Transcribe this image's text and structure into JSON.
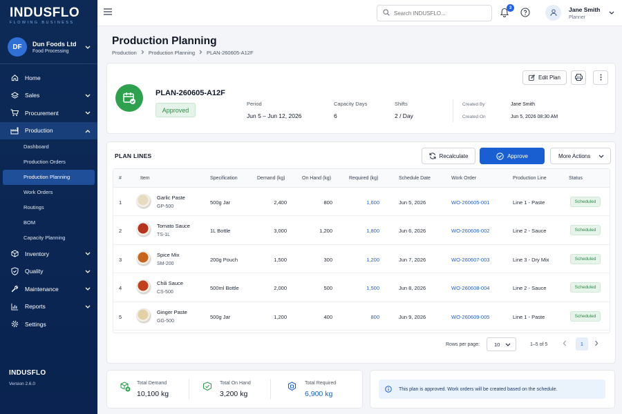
{
  "sidebar": {
    "brand": "INDUSFLO",
    "tagline": "FLOWING BUSINESS",
    "company": {
      "initials": "DF",
      "name": "Dun Foods Ltd",
      "sub": "Food Processing"
    },
    "nav": [
      {
        "label": "Home",
        "icon": "home-icon"
      },
      {
        "label": "Sales",
        "icon": "sales-icon"
      },
      {
        "label": "Procurement",
        "icon": "cart-icon"
      },
      {
        "label": "Production",
        "icon": "factory-icon"
      }
    ],
    "production_sub": [
      "Dashboard",
      "Production Orders",
      "Production Planning",
      "Work Orders",
      "Routings",
      "BOM",
      "Capacity Planning"
    ],
    "nav_bottom": [
      {
        "label": "Inventory",
        "icon": "box-icon"
      },
      {
        "label": "Quality",
        "icon": "shield-check-icon"
      },
      {
        "label": "Maintenance",
        "icon": "wrench-icon"
      },
      {
        "label": "Reports",
        "icon": "chart-icon"
      },
      {
        "label": "Settings",
        "icon": "gear-icon"
      }
    ],
    "footer_brand": "INDUSFLO",
    "version": "Version 2.6.0"
  },
  "header": {
    "search_placeholder": "Search INDUSFLO...",
    "notification_count": "3",
    "user_name": "Jane Smith",
    "user_role": "Planner"
  },
  "page": {
    "title": "Production Planning",
    "breadcrumb": [
      "Production",
      "Production Planning",
      "PLAN-260605-A12F"
    ]
  },
  "plan": {
    "id": "PLAN-260605-A12F",
    "status": "Approved",
    "period_label": "Period",
    "period_value": "Jun 5 – Jun 12, 2026",
    "capacity_label": "Capacity Days",
    "capacity_value": "6",
    "shifts_label": "Shifts",
    "shifts_value": "2 / Day",
    "created_by_label": "Created By",
    "created_by_value": "Jane Smith",
    "created_on_label": "Created On",
    "created_on_value": "Jun 5, 2026 08:30 AM",
    "edit_label": "Edit Plan"
  },
  "plan_lines": {
    "title": "PLAN LINES",
    "recalc_label": "Recalculate",
    "approve_label": "Approve",
    "more_label": "More Actions",
    "columns": [
      "#",
      "Item",
      "Specification",
      "Demand (kg)",
      "On Hand (kg)",
      "Required (kg)",
      "Schedule Date",
      "Work Order",
      "Production Line",
      "Status"
    ],
    "rows": [
      {
        "n": "1",
        "name": "Garlic Paste",
        "code": "GP-500",
        "spec": "500g Jar",
        "demand": "2,400",
        "onhand": "800",
        "required": "1,600",
        "date": "Jun 5, 2026",
        "wo": "WO-260605-001",
        "line": "Line 1 - Paste",
        "status": "Scheduled",
        "color": "#e8dcc0"
      },
      {
        "n": "2",
        "name": "Tomato Sauce",
        "code": "TS-1L",
        "spec": "1L Bottle",
        "demand": "3,000",
        "onhand": "1,200",
        "required": "1,800",
        "date": "Jun 6, 2026",
        "wo": "WO-260606-002",
        "line": "Line 2 - Sauce",
        "status": "Scheduled",
        "color": "#b8321e"
      },
      {
        "n": "3",
        "name": "Spice Mix",
        "code": "SM-200",
        "spec": "200g Pouch",
        "demand": "1,500",
        "onhand": "300",
        "required": "1,200",
        "date": "Jun 7, 2026",
        "wo": "WO-260607-003",
        "line": "Line 3 - Dry Mix",
        "status": "Scheduled",
        "color": "#c8651c"
      },
      {
        "n": "4",
        "name": "Chili Sauce",
        "code": "CS-500",
        "spec": "500ml Bottle",
        "demand": "2,000",
        "onhand": "500",
        "required": "1,500",
        "date": "Jun 8, 2026",
        "wo": "WO-260608-004",
        "line": "Line 2 - Sauce",
        "status": "Scheduled",
        "color": "#c2401c"
      },
      {
        "n": "5",
        "name": "Ginger Paste",
        "code": "GG-500",
        "spec": "500g Jar",
        "demand": "1,200",
        "onhand": "400",
        "required": "800",
        "date": "Jun 9, 2026",
        "wo": "WO-260609-005",
        "line": "Line 1 - Paste",
        "status": "Scheduled",
        "color": "#e2d3a6"
      }
    ],
    "rows_per_page_label": "Rows per page:",
    "rows_per_page": "10",
    "range": "1–5 of 5",
    "page": "1"
  },
  "totals": {
    "demand_label": "Total Demand",
    "demand_value": "10,100 kg",
    "onhand_label": "Total On Hand",
    "onhand_value": "3,200 kg",
    "required_label": "Total Required",
    "required_value": "6,900 kg"
  },
  "info_message": "This plan is approved. Work orders will be created based on the schedule.",
  "colors": {
    "sidebar": "#0d2a57",
    "accent": "#1a5fd2",
    "success": "#2ea14e"
  }
}
